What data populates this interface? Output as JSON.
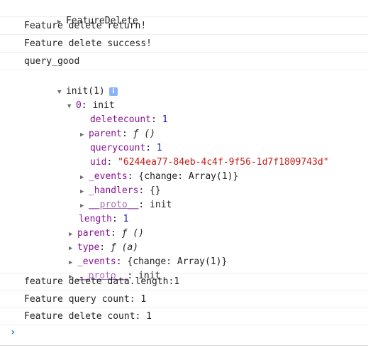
{
  "console": {
    "feature_delete_group": "FeatureDelete",
    "msg_return": "Feature delete return!",
    "msg_success": "Feature delete success!",
    "msg_query": "query_good",
    "init_label": "init(1)",
    "info_badge": "i",
    "item0_key": "0",
    "item0_val": "init",
    "deletecount_key": "deletecount",
    "deletecount_val": "1",
    "parent_key": "parent",
    "parent_val": "ƒ ()",
    "querycount_key": "querycount",
    "querycount_val": "1",
    "uid_key": "uid",
    "uid_val": "\"6244ea77-84eb-4c4f-9f56-1d7f1809743d\"",
    "events_key": "_events",
    "events_val": "{change: Array(1)}",
    "handlers_key": "_handlers",
    "handlers_val": "{}",
    "proto_key": "__proto__",
    "proto_val": "init",
    "length_key": "length",
    "length_val": "1",
    "parent2_key": "parent",
    "parent2_val": "ƒ ()",
    "type_key": "type",
    "type_val": "ƒ (a)",
    "events2_key": "_events",
    "events2_val": "{change: Array(1)}",
    "proto2_key": "__proto__",
    "proto2_val": "init",
    "msg_length": "feature delete data.length:1",
    "msg_query_count": "Feature query count: 1",
    "msg_delete_count": "Feature delete count: 1",
    "prompt_symbol": "›"
  }
}
